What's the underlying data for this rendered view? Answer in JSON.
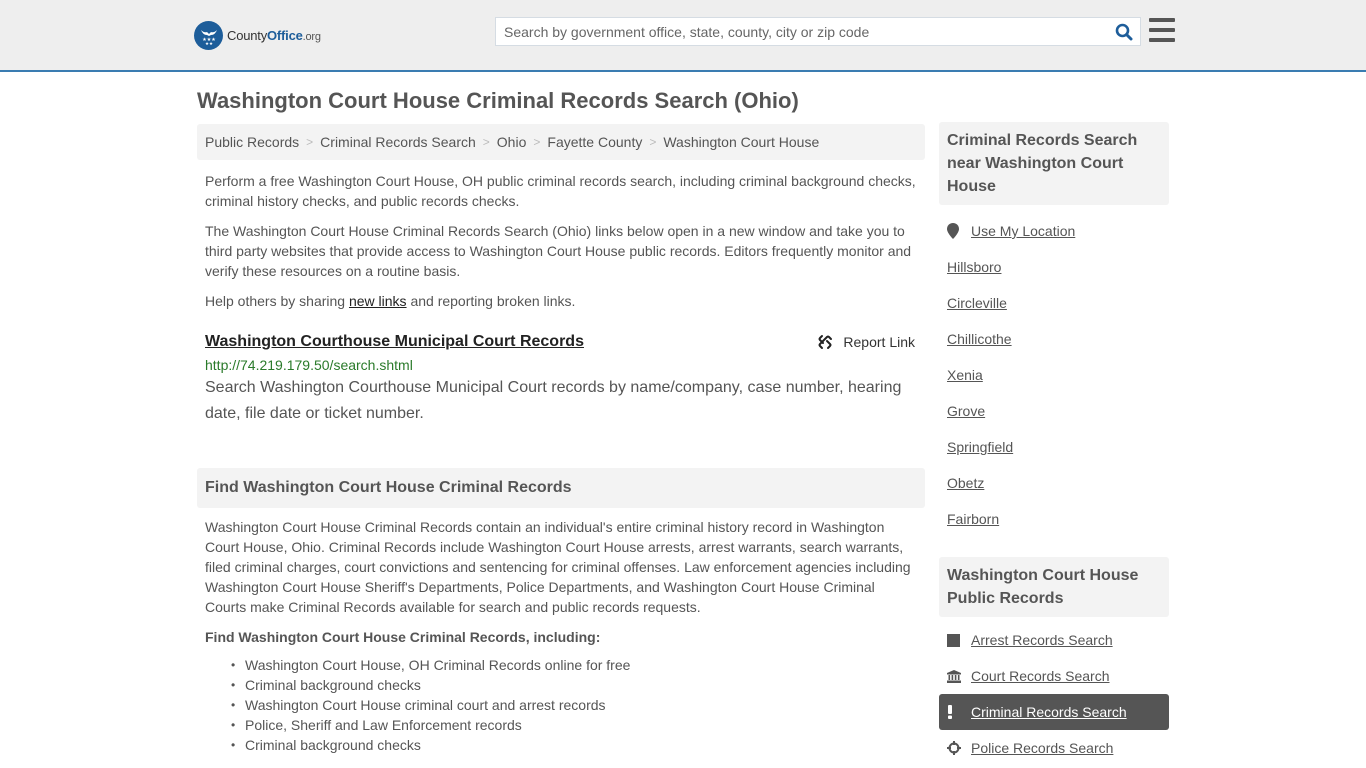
{
  "header": {
    "logo": {
      "part1": "County",
      "part2": "Office",
      "part3": ".org"
    },
    "search_placeholder": "Search by government office, state, county, city or zip code",
    "search_value": "",
    "icons": {
      "search": "search-icon",
      "menu": "hamburger-menu-icon",
      "logo": "eagle-stars-logo"
    }
  },
  "page": {
    "title": "Washington Court House Criminal Records Search (Ohio)"
  },
  "breadcrumb": [
    "Public Records",
    "Criminal Records Search",
    "Ohio",
    "Fayette County",
    "Washington Court House"
  ],
  "intro": {
    "p1": "Perform a free Washington Court House, OH public criminal records search, including criminal background checks, criminal history checks, and public records checks.",
    "p2": "The Washington Court House Criminal Records Search (Ohio) links below open in a new window and take you to third party websites that provide access to Washington Court House public records. Editors frequently monitor and verify these resources on a routine basis.",
    "p3_before": "Help others by sharing ",
    "p3_link": "new links",
    "p3_after": " and reporting broken links."
  },
  "results": [
    {
      "title": "Washington Courthouse Municipal Court Records",
      "url": "http://74.219.179.50/search.shtml",
      "description": "Search Washington Courthouse Municipal Court records by name/company, case number, hearing date, file date or ticket number.",
      "report_label": "Report Link"
    }
  ],
  "find_section": {
    "heading": "Find Washington Court House Criminal Records",
    "body": "Washington Court House Criminal Records contain an individual's entire criminal history record in Washington Court House, Ohio. Criminal Records include Washington Court House arrests, arrest warrants, search warrants, filed criminal charges, court convictions and sentencing for criminal offenses. Law enforcement agencies including Washington Court House Sheriff's Departments, Police Departments, and Washington Court House Criminal Courts make Criminal Records available for search and public records requests.",
    "list_heading": "Find Washington Court House Criminal Records, including:",
    "items": [
      "Washington Court House, OH Criminal Records online for free",
      "Criminal background checks",
      "Washington Court House criminal court and arrest records",
      "Police, Sheriff and Law Enforcement records",
      "Criminal background checks"
    ]
  },
  "sidebar": {
    "nearby_heading": "Criminal Records Search near Washington Court House",
    "use_location": "Use My Location",
    "nearby": [
      "Hillsboro",
      "Circleville",
      "Chillicothe",
      "Xenia",
      "Grove",
      "Springfield",
      "Obetz",
      "Fairborn"
    ],
    "records_heading": "Washington Court House Public Records",
    "records": [
      {
        "label": "Arrest Records Search",
        "icon": "square-icon",
        "active": false
      },
      {
        "label": "Court Records Search",
        "icon": "courthouse-icon",
        "active": false
      },
      {
        "label": "Criminal Records Search",
        "icon": "exclamation-icon",
        "active": true
      },
      {
        "label": "Police Records Search",
        "icon": "crosshair-icon",
        "active": false
      }
    ],
    "active_bg": "#555555"
  },
  "colors": {
    "brand_blue": "#1d5d9a",
    "header_border": "#3a7cb1",
    "url_green": "#2a7a2a"
  }
}
